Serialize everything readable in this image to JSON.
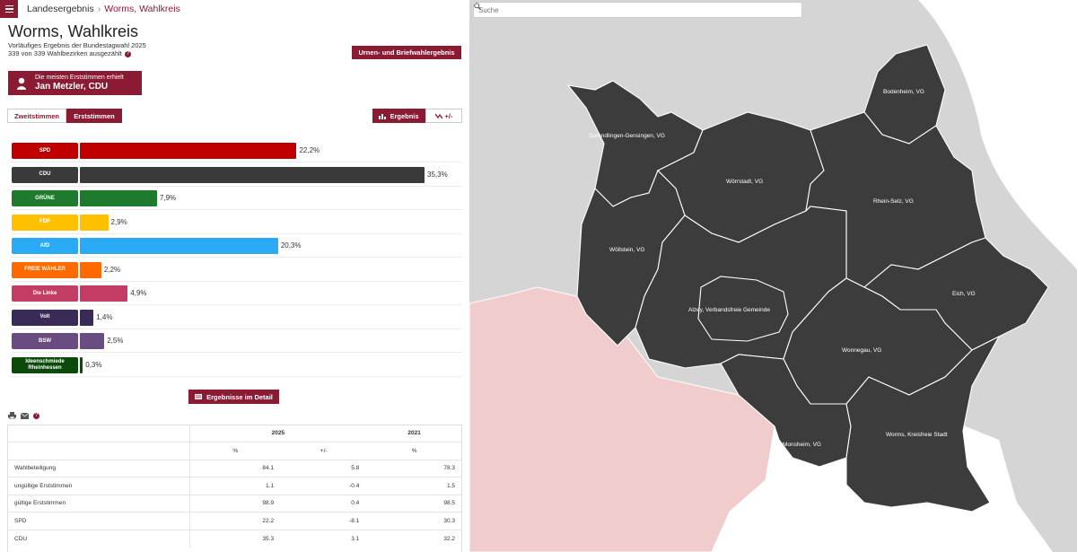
{
  "breadcrumb": {
    "home": "Landesergebnis",
    "current": "Worms, Wahlkreis"
  },
  "header": {
    "title": "Worms, Wahlkreis",
    "subtitle": "Vorläufiges Ergebnis der Bundestagwahl 2025",
    "counted": "339 von 339 Wahlbezirken ausgezählt",
    "help": "?",
    "urnen_button": "Urnen- und Briefwahlergebnis"
  },
  "winner": {
    "line1": "Die meisten Erststimmen erhielt",
    "line2": "Jan Metzler, CDU"
  },
  "tabs": {
    "zweit": "Zweitstimmen",
    "erst": "Erststimmen",
    "ergebnis": "Ergebnis",
    "plusminus": "+/-"
  },
  "chart_data": {
    "type": "bar",
    "orientation": "horizontal",
    "categories": [
      "SPD",
      "CDU",
      "GRÜNE",
      "FDP",
      "AfD",
      "FREIE WÄHLER",
      "Die Linke",
      "Volt",
      "BSW",
      "Ideenschmiede Rheinhessen"
    ],
    "values": [
      22.2,
      35.3,
      7.9,
      2.9,
      20.3,
      2.2,
      4.9,
      1.4,
      2.5,
      0.3
    ],
    "value_labels": [
      "22,2%",
      "35,3%",
      "7,9%",
      "2,9%",
      "20,3%",
      "2,2%",
      "4,9%",
      "1,4%",
      "2,5%",
      "0,3%"
    ],
    "colors": [
      "#c00000",
      "#3a3a3a",
      "#1e7a2c",
      "#ffc000",
      "#2aa9f5",
      "#ff6a00",
      "#c33c63",
      "#3a2a57",
      "#6a4c82",
      "#0c4a0c"
    ],
    "xlim": [
      0,
      35.3
    ]
  },
  "detail_button": "Ergebnisse im Detail",
  "tools": {
    "print": "print-icon",
    "mail": "mail-icon",
    "help": "?"
  },
  "table": {
    "years": [
      "2025",
      "2021"
    ],
    "subheaders": [
      "%",
      "+/-",
      "%"
    ],
    "rows": [
      {
        "label": "Wahlbeteiligung",
        "v2025": "84.1",
        "diff": "5.8",
        "v2021": "78.3"
      },
      {
        "label": "ungültige Erststimmen",
        "v2025": "1.1",
        "diff": "-0.4",
        "v2021": "1.5"
      },
      {
        "label": "gültige Erststimmen",
        "v2025": "98.9",
        "diff": "0.4",
        "v2021": "98.5"
      },
      {
        "label": "SPD",
        "v2025": "22.2",
        "diff": "-8.1",
        "v2021": "30.3"
      },
      {
        "label": "CDU",
        "v2025": "35.3",
        "diff": "3.1",
        "v2021": "32.2"
      }
    ]
  },
  "map": {
    "search_placeholder": "Suche",
    "labels": [
      "Bodenheim, VG",
      "Sprendlingen-Gensingen, VG",
      "Wörrstadt, VG",
      "Rhein-Selz, VG",
      "Wöllstein, VG",
      "Eich, VG",
      "Alzey, Verbandsfreie Gemeinde",
      "Wonnegau, VG",
      "Monsheim, VG",
      "Worms, Kreisfreie Stadt"
    ],
    "colors": {
      "district": "#3c3c3c",
      "neighbor": "#d5d5d5",
      "neighbor_state": "#f1cccc"
    }
  }
}
